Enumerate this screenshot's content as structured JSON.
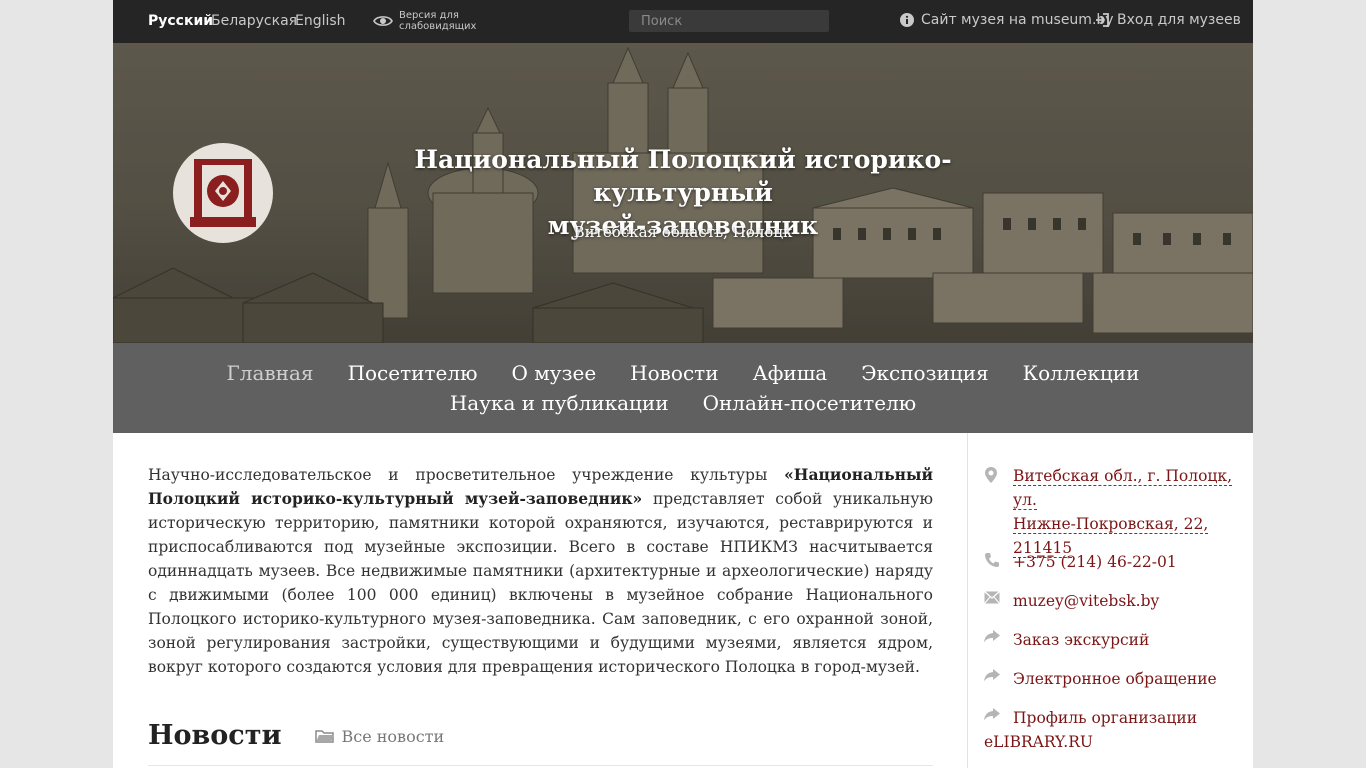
{
  "topbar": {
    "languages": [
      "Русский",
      "Беларуская",
      "English"
    ],
    "vision_label": "Версия для слабовидящих",
    "search_placeholder": "Поиск",
    "museum_site_label": "Сайт музея на museum.by",
    "login_label": "Вход для музеев"
  },
  "hero": {
    "title_line1": "Национальный Полоцкий историко-культурный",
    "title_line2": "музей-заповедник",
    "location": "Витебская область, Полоцк"
  },
  "nav": {
    "row1": [
      "Главная",
      "Посетителю",
      "О музее",
      "Новости",
      "Афиша",
      "Экспозиция",
      "Коллекции"
    ],
    "row2": [
      "Наука и публикации",
      "Онлайн-посетителю"
    ],
    "active": "Главная"
  },
  "main": {
    "intro_prefix": "Научно-исследовательское и просветительное учреждение культуры ",
    "intro_bold": "«Национальный Полоцкий историко-культурный музей-заповедник»",
    "intro_suffix": " представляет собой уникальную историческую территорию, памятники которой охраняются, изучаются, реставрируются и приспосабливаются под музейные экспозиции. Всего в составе НПИКМЗ насчитывается одиннадцать музеев. Все недвижимые памятники (архитектурные и археологические) наряду с движимыми (более 100 000 единиц) включены в музейное собрание Национального Полоцкого историко-культурного музея-заповедника. Сам заповедник, с его охранной зоной, зоной регулирования застройки, существующими и будущими музеями, является ядром, вокруг которого создаются условия для превращения исторического Полоцка в город-музей.",
    "news_title": "Новости",
    "all_news_label": "Все новости"
  },
  "sidebar": {
    "address_l1": "Витебская обл., г. Полоцк, ул.",
    "address_l2": "Нижне-Покровская, 22,",
    "address_l3": "211415",
    "phone": "+375 (214) 46-22-01",
    "email": "muzey@vitebsk.by",
    "excursion": "Заказ экскурсий",
    "appeal": "Электронное обращение",
    "profile_l1": "Профиль организации",
    "profile_l2": "eLIBRARY.RU"
  },
  "colors": {
    "link": "#7b1515",
    "topbar": "#252525",
    "nav": "#606060"
  },
  "icons": [
    "eye-icon",
    "info-icon",
    "login-icon",
    "logo-emblem",
    "map-pin-icon",
    "phone-icon",
    "mail-icon",
    "share-arrow-icon",
    "folder-icon"
  ]
}
